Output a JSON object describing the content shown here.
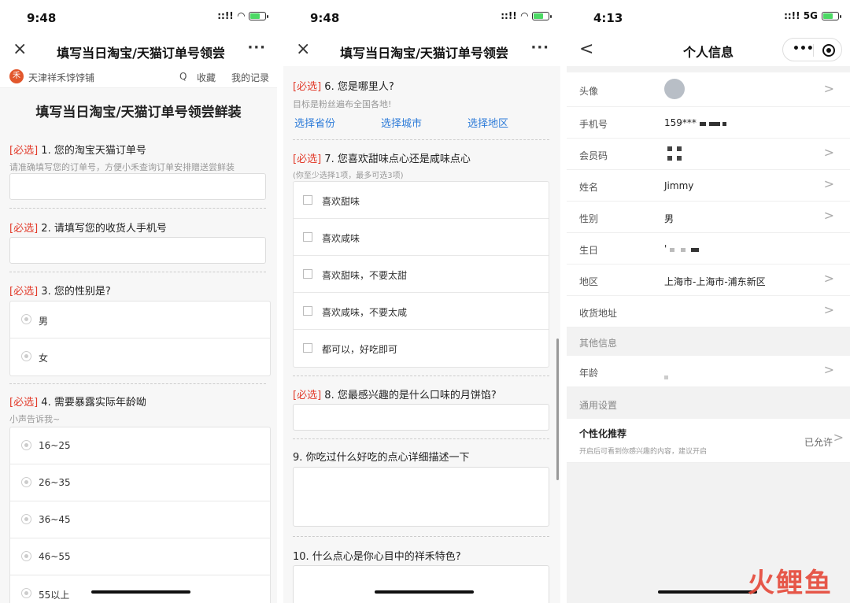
{
  "phone1": {
    "status": {
      "time": "9:48",
      "signal": "::!!"
    },
    "nav": {
      "close": "×",
      "title": "填写当日淘宝/天猫订单号领尝",
      "more": "···"
    },
    "shop": {
      "logo": "禾",
      "name": "天津祥禾饽饽铺",
      "search": "Q",
      "fav": "收藏",
      "records": "我的记录"
    },
    "form_title": "填写当日淘宝/天猫订单号领尝鲜装",
    "required_tag": "[必选]",
    "q1": {
      "text": "1. 您的淘宝天猫订单号",
      "hint": "请准确填写您的订单号，方便小禾查询订单安排赠送尝鲜装"
    },
    "q2": {
      "text": "2. 请填写您的收货人手机号"
    },
    "q3": {
      "text": "3. 您的性别是?",
      "options": [
        "男",
        "女"
      ]
    },
    "q4": {
      "text": "4. 需要暴露实际年龄呦",
      "hint": "小声告诉我~",
      "options": [
        "16~25",
        "26~35",
        "36~45",
        "46~55",
        "55以上"
      ]
    }
  },
  "phone2": {
    "status": {
      "time": "9:48",
      "signal": "::!!"
    },
    "nav": {
      "close": "×",
      "title": "填写当日淘宝/天猫订单号领尝",
      "more": "···"
    },
    "required_tag": "[必选]",
    "q6": {
      "text": "6. 您是哪里人?",
      "hint": "目标是粉丝遍布全国各地!",
      "links": [
        "选择省份",
        "选择城市",
        "选择地区"
      ]
    },
    "q7": {
      "text": "7. 您喜欢甜味点心还是咸味点心",
      "hint": "(你至少选择1项，最多可选3项)",
      "options": [
        "喜欢甜味",
        "喜欢咸味",
        "喜欢甜味，不要太甜",
        "喜欢咸味，不要太咸",
        "都可以，好吃即可"
      ]
    },
    "q8": {
      "text": "8. 您最感兴趣的是什么口味的月饼馅?"
    },
    "q9": {
      "text": "9. 你吃过什么好吃的点心详细描述一下"
    },
    "q10": {
      "text": "10. 什么点心是你心目中的祥禾特色?"
    }
  },
  "phone3": {
    "status": {
      "time": "4:13",
      "signal": "::!! 5G"
    },
    "nav": {
      "back": "<",
      "title": "个人信息",
      "dots": "•••"
    },
    "rows": {
      "avatar": "头像",
      "phone": {
        "label": "手机号",
        "value": "159***"
      },
      "member_code": "会员码",
      "name": {
        "label": "姓名",
        "value": "Jimmy"
      },
      "gender": {
        "label": "性别",
        "value": "男"
      },
      "birthday": {
        "label": "生日",
        "value": "'"
      },
      "region": {
        "label": "地区",
        "value": "上海市-上海市-浦东新区"
      },
      "address": {
        "label": "收货地址"
      },
      "age": {
        "label": "年龄"
      }
    },
    "sections": {
      "other": "其他信息",
      "general": "通用设置"
    },
    "personal": {
      "label": "个性化推荐",
      "desc": "开启后可看到你感兴趣的内容，建议开启",
      "status": "已允许"
    },
    "chevron": ">",
    "watermark": "火鲤鱼"
  }
}
